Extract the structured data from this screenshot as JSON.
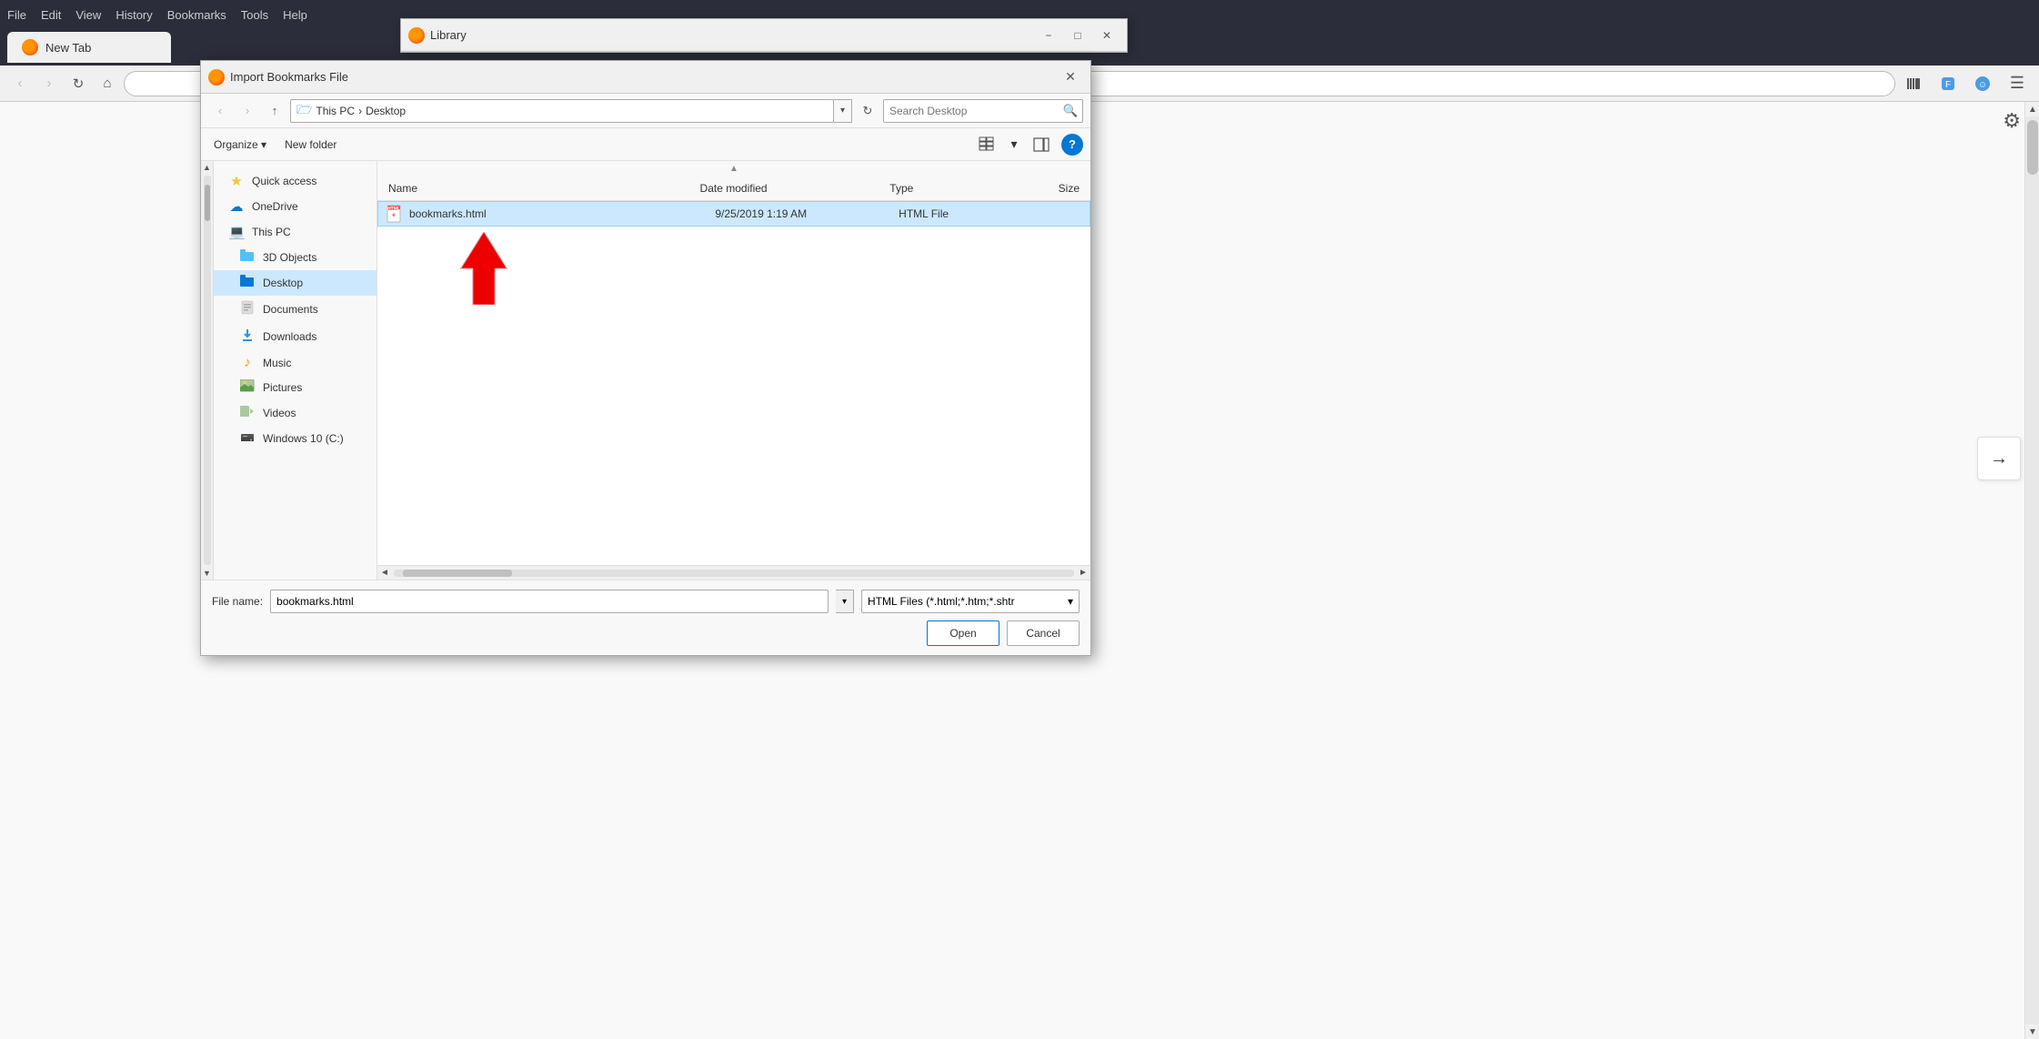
{
  "browser": {
    "menu_items": [
      "File",
      "Edit",
      "View",
      "History",
      "Bookmarks",
      "Tools",
      "Help"
    ],
    "tab_title": "New Tab",
    "nav_back_title": "Back",
    "nav_forward_title": "Forward",
    "nav_reload_title": "Reload",
    "nav_home_title": "Home"
  },
  "library_window": {
    "title": "Library",
    "minimize_label": "−",
    "maximize_label": "□",
    "close_label": "✕"
  },
  "import_dialog": {
    "title": "Import Bookmarks File",
    "close_label": "✕",
    "breadcrumb": {
      "parts": [
        "This PC",
        "Desktop"
      ],
      "separator": "›"
    },
    "search_placeholder": "Search Desktop",
    "organize_label": "Organize ▾",
    "new_folder_label": "New folder",
    "columns": {
      "name": "Name",
      "date_modified": "Date modified",
      "type": "Type",
      "size": "Size"
    },
    "sidebar_items": [
      {
        "id": "quick-access",
        "label": "Quick access",
        "icon_type": "star",
        "selected": false
      },
      {
        "id": "onedrive",
        "label": "OneDrive",
        "icon_type": "cloud",
        "selected": false
      },
      {
        "id": "this-pc",
        "label": "This PC",
        "icon_type": "computer",
        "selected": false
      },
      {
        "id": "3d-objects",
        "label": "3D Objects",
        "icon_type": "box3d",
        "selected": false,
        "indent": true
      },
      {
        "id": "desktop",
        "label": "Desktop",
        "icon_type": "desktop",
        "selected": true,
        "indent": true
      },
      {
        "id": "documents",
        "label": "Documents",
        "icon_type": "documents",
        "selected": false,
        "indent": true
      },
      {
        "id": "downloads",
        "label": "Downloads",
        "icon_type": "download",
        "selected": false,
        "indent": true
      },
      {
        "id": "music",
        "label": "Music",
        "icon_type": "music",
        "selected": false,
        "indent": true
      },
      {
        "id": "pictures",
        "label": "Pictures",
        "icon_type": "pictures",
        "selected": false,
        "indent": true
      },
      {
        "id": "videos",
        "label": "Videos",
        "icon_type": "videos",
        "selected": false,
        "indent": true
      },
      {
        "id": "windows-c",
        "label": "Windows 10 (C:)",
        "icon_type": "drive",
        "selected": false,
        "indent": true
      }
    ],
    "files": [
      {
        "name": "bookmarks.html",
        "date_modified": "9/25/2019 1:19 AM",
        "type": "HTML File",
        "size": "",
        "selected": true
      }
    ],
    "file_name_label": "File name:",
    "file_name_value": "bookmarks.html",
    "file_type_value": "HTML Files (*.html;*.htm;*.shtr",
    "open_label": "Open",
    "cancel_label": "Cancel"
  },
  "icons": {
    "back": "‹",
    "forward": "›",
    "up": "↑",
    "refresh": "↻",
    "search": "🔍",
    "view_grid": "⊞",
    "view_pane": "⬜",
    "help": "?",
    "dropdown": "▾",
    "chevron_right": "›",
    "chevron_down": "▾",
    "scroll_up": "▲",
    "scroll_down": "▼",
    "scroll_left": "◄",
    "scroll_right": "►",
    "gear": "⚙",
    "arrow_right": "→",
    "library_icon": "📚",
    "bookmarks_icon": "☆",
    "history_icon": "⏱",
    "grid_lines": "≡",
    "hamburger": "☰",
    "minimize": "−",
    "maximize": "□",
    "close": "✕"
  },
  "annotation": {
    "red_arrow_present": true
  }
}
